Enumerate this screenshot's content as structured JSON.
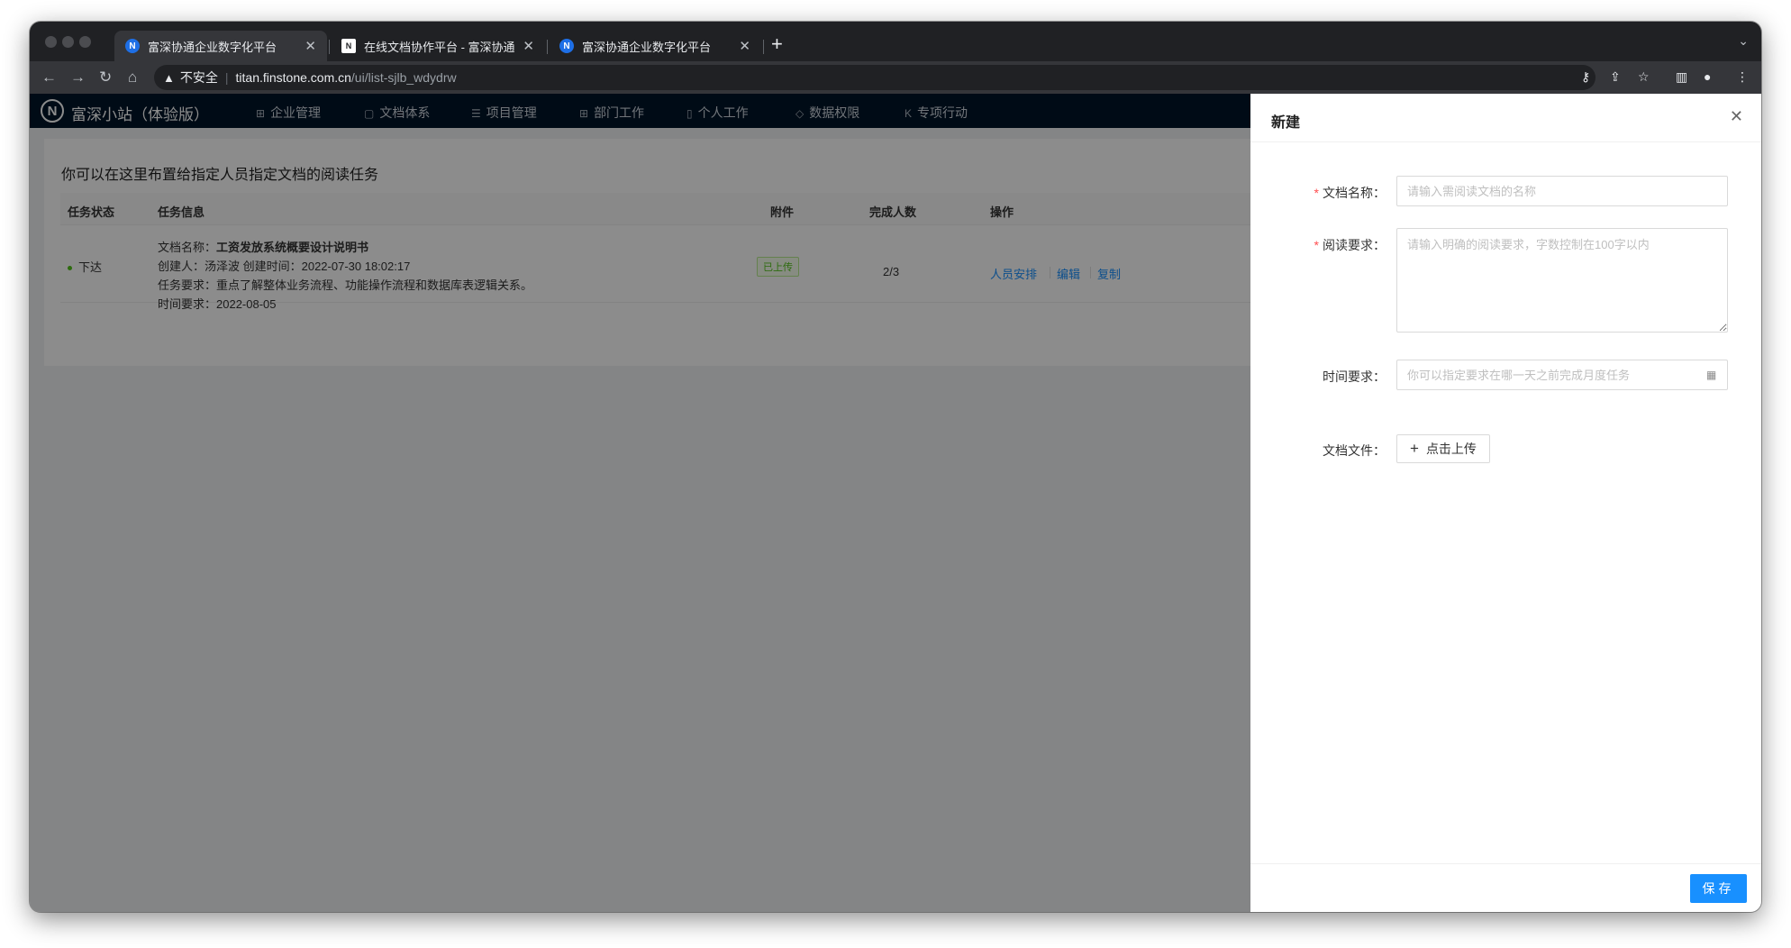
{
  "browser": {
    "tabs": [
      {
        "title": "富深协通企业数字化平台",
        "favicon": "N",
        "active": true
      },
      {
        "title": "在线文档协作平台 - 富深协通",
        "favicon": "N",
        "active": false
      },
      {
        "title": "富深协通企业数字化平台",
        "favicon": "N",
        "active": false
      }
    ],
    "new_tab": "+",
    "address": {
      "security_label": "不安全",
      "host": "titan.finstone.com.cn",
      "path": "/ui/list-sjlb_wdydrw"
    }
  },
  "app": {
    "logo": "N",
    "name": "富深小站（体验版）",
    "nav": [
      {
        "label": "企业管理",
        "icon": "building-icon"
      },
      {
        "label": "文档体系",
        "icon": "file-icon"
      },
      {
        "label": "项目管理",
        "icon": "list-icon"
      },
      {
        "label": "部门工作",
        "icon": "grid-icon"
      },
      {
        "label": "个人工作",
        "icon": "bookmark-icon"
      },
      {
        "label": "数据权限",
        "icon": "shield-icon"
      },
      {
        "label": "专项行动",
        "icon": "k-icon"
      }
    ]
  },
  "page": {
    "hint": "你可以在这里布置给指定人员指定文档的阅读任务",
    "table": {
      "headers": [
        "任务状态",
        "任务信息",
        "附件",
        "完成人数",
        "操作"
      ],
      "rows": [
        {
          "status": "下达",
          "info": {
            "doc_label": "文档名称：",
            "doc_name": "工资发放系统概要设计说明书",
            "creator_line": "创建人：汤泽波 创建时间：2022-07-30 18:02:17",
            "requirement_line": "任务要求：重点了解整体业务流程、功能操作流程和数据库表逻辑关系。",
            "deadline_line": "时间要求：2022-08-05"
          },
          "attachment": "已上传",
          "completed": "2/3",
          "actions": [
            "人员安排",
            "编辑",
            "复制"
          ]
        }
      ]
    }
  },
  "drawer": {
    "title": "新建",
    "fields": {
      "doc_name": {
        "label": "文档名称：",
        "required": true,
        "placeholder": "请输入需阅读文档的名称"
      },
      "requirement": {
        "label": "阅读要求：",
        "required": true,
        "placeholder": "请输入明确的阅读要求，字数控制在100字以内"
      },
      "deadline": {
        "label": "时间要求：",
        "required": false,
        "placeholder": "你可以指定要求在哪一天之前完成月度任务"
      },
      "file": {
        "label": "文档文件：",
        "required": false,
        "button": "点击上传"
      }
    },
    "save": "保存"
  },
  "colors": {
    "primary": "#1890ff",
    "nav_bg": "#001529",
    "success": "#52c41a",
    "required": "#ff4d4f"
  }
}
